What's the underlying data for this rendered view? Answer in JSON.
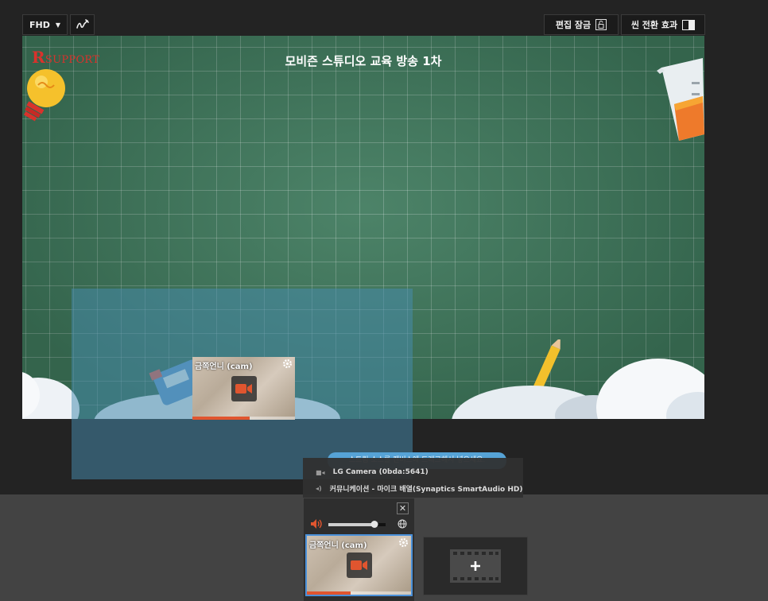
{
  "toolbar": {
    "resolution": "FHD",
    "resolution_caret": "▼",
    "edit_lock_label": "편집 잠금",
    "transition_label": "씬 전환 효과"
  },
  "stage": {
    "brand_mark": "R",
    "brand_text": "SUPPORT",
    "title": "모비즌 스튜디오 교육 방송 1차"
  },
  "cam_source": {
    "label": "금쪽언니 (cam)",
    "bar_level": 0.56
  },
  "tooltip": {
    "text": "스트림 소스를 캔버스에 드래그해서 넣으세요."
  },
  "source_menu": {
    "items": [
      {
        "icon": "camera-icon",
        "label": "LG Camera (0bda:5641)"
      },
      {
        "icon": "speaker-icon",
        "label": "커뮤니케이션 - 마이크 배열(Synaptics SmartAudio HD)"
      }
    ]
  },
  "dock": {
    "close_glyph": "✕",
    "volume_level": 0.8,
    "dock_cam_bar_level": 0.42
  },
  "colors": {
    "board": "#3f7a5d",
    "accent_blue": "#4a90d9",
    "cam_orange": "#e0552f",
    "brand_red": "#d9322c"
  }
}
